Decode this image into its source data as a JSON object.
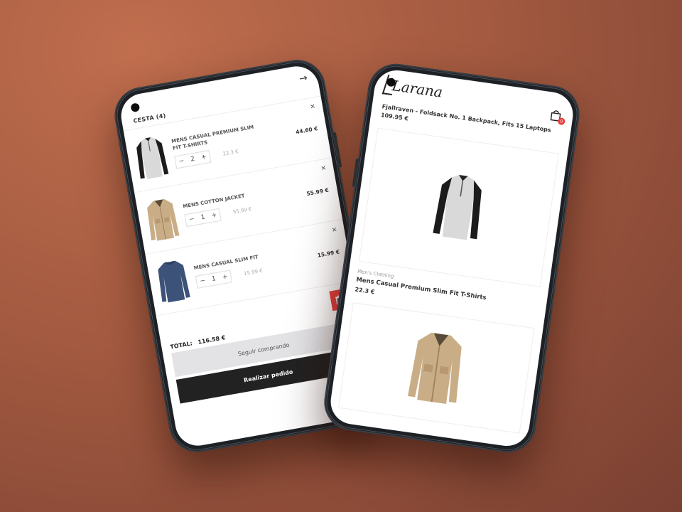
{
  "cart": {
    "title": "CESTA (4)",
    "items": [
      {
        "name": "MENS CASUAL PREMIUM SLIM FIT T-SHIRTS",
        "qty": "2",
        "unit_price": "22.3 €",
        "line_total": "44.60 €",
        "image": "raglan-tshirt"
      },
      {
        "name": "MENS COTTON JACKET",
        "qty": "1",
        "unit_price": "55.99 €",
        "line_total": "55.99 €",
        "image": "cotton-jacket"
      },
      {
        "name": "MENS CASUAL SLIM FIT",
        "qty": "1",
        "unit_price": "15.99 €",
        "line_total": "15.99 €",
        "image": "navy-longsleeve"
      }
    ],
    "stepper": {
      "minus": "−",
      "plus": "+"
    },
    "remove_symbol": "✕",
    "total_label": "TOTAL:",
    "total_value": "116.58 €",
    "continue_label": "Seguir comprando",
    "order_label": "Realizar pedido",
    "accent_color": "#e8403c"
  },
  "shop": {
    "brand": "Larana",
    "bag_count": "0",
    "previous_product": {
      "title": "Fjallraven - Foldsack No. 1 Backpack, Fits 15 Laptops",
      "price": "109.95 €"
    },
    "product": {
      "category": "Men's Clothing",
      "name": "Mens Casual Premium Slim Fit T-Shirts",
      "price": "22.3 €"
    },
    "next_product_image": "cotton-jacket"
  },
  "icons": {
    "back": "arrow-right-icon",
    "remove": "close-icon",
    "trash": "trash-icon",
    "bag": "shopping-bag-icon"
  }
}
